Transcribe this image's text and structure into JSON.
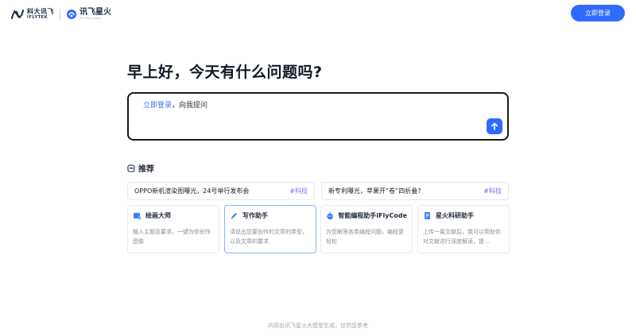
{
  "header": {
    "logo_iflytek_cn": "科大讯飞",
    "logo_iflytek_en": "IFLYTEK",
    "logo_spark_cn": "讯飞星火",
    "logo_spark_en": "iFLYTEK SPARK",
    "login_button": "立即登录"
  },
  "main": {
    "greeting": "早上好，今天有什么问题吗?",
    "input_link": "立即登录",
    "input_suffix": "，向我提问",
    "recommend_title": "推荐"
  },
  "news": [
    {
      "text": "OPPO新机渲染图曝光，24号举行发布会",
      "tag": "#科技"
    },
    {
      "text": "新专利曝光，苹果开“卷”四折叠?",
      "tag": "#科技"
    }
  ],
  "tools": [
    {
      "name": "绘画大师",
      "desc": "输入主题及要求，一键为你创作图像",
      "icon": "paint-icon"
    },
    {
      "name": "写作助手",
      "desc": "请说出您要创作的文章的类型，以及文章的要求",
      "icon": "pen-icon"
    },
    {
      "name": "智能编程助手iFlyCode",
      "desc": "为您解答各类编程问题，编程更轻松",
      "icon": "robot-icon"
    },
    {
      "name": "星火科研助手",
      "desc": "上传一篇文献后，我可以帮助你对文献进行深度解读，提...",
      "icon": "document-icon"
    }
  ],
  "footer": "内容由讯飞星火大模型生成，仅供您参考",
  "colors": {
    "accent": "#2f6bff",
    "tag": "#7b6cf6"
  }
}
